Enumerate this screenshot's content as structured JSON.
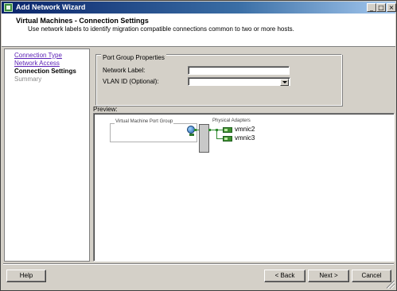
{
  "window": {
    "title": "Add Network Wizard",
    "icon": "wizard-icon",
    "controls": {
      "minimize": "_",
      "maximize": "□",
      "close": "×"
    }
  },
  "header": {
    "title": "Virtual Machines - Connection Settings",
    "description": "Use network labels to identify migration compatible connections common to two or more hosts."
  },
  "nav": {
    "items": [
      {
        "label": "Connection Type",
        "state": "link"
      },
      {
        "label": "Network Access",
        "state": "link"
      },
      {
        "label": "Connection Settings",
        "state": "current"
      },
      {
        "label": "Summary",
        "state": "future"
      }
    ]
  },
  "port_group": {
    "legend": "Port Group Properties",
    "network_label": {
      "label": "Network Label:",
      "value": ""
    },
    "vlan_id": {
      "label": "VLAN ID (Optional):",
      "value": ""
    }
  },
  "preview": {
    "label": "Preview:",
    "vm_port_group_caption": "Virtual Machine Port Group",
    "physical_adapters_caption": "Physical Adapters",
    "adapters": [
      "vmnic2",
      "vmnic3"
    ]
  },
  "buttons": {
    "help": "Help",
    "back": "< Back",
    "next": "Next >",
    "cancel": "Cancel"
  }
}
